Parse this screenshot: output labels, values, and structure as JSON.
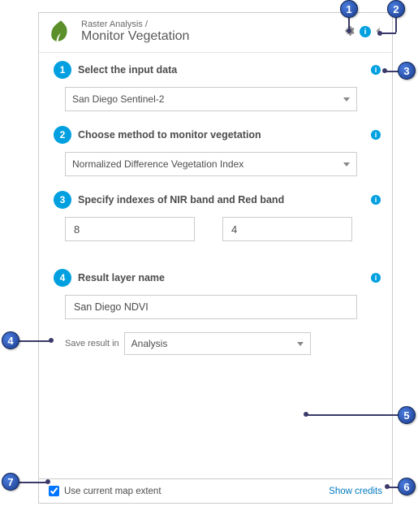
{
  "header": {
    "breadcrumb": "Raster Analysis /",
    "title": "Monitor Vegetation",
    "info_glyph": "i"
  },
  "steps": [
    {
      "num": "1",
      "label": "Select the input data",
      "value": "San Diego Sentinel-2"
    },
    {
      "num": "2",
      "label": "Choose method to monitor vegetation",
      "value": "Normalized Difference Vegetation Index"
    },
    {
      "num": "3",
      "label": "Specify indexes of NIR band and Red band",
      "nir": "8",
      "red": "4"
    },
    {
      "num": "4",
      "label": "Result layer name",
      "value": "San Diego NDVI"
    }
  ],
  "save": {
    "label": "Save result in",
    "value": "Analysis"
  },
  "footer": {
    "extent_label": "Use current map extent",
    "credits": "Show credits"
  },
  "callouts": [
    "1",
    "2",
    "3",
    "4",
    "5",
    "6",
    "7"
  ]
}
